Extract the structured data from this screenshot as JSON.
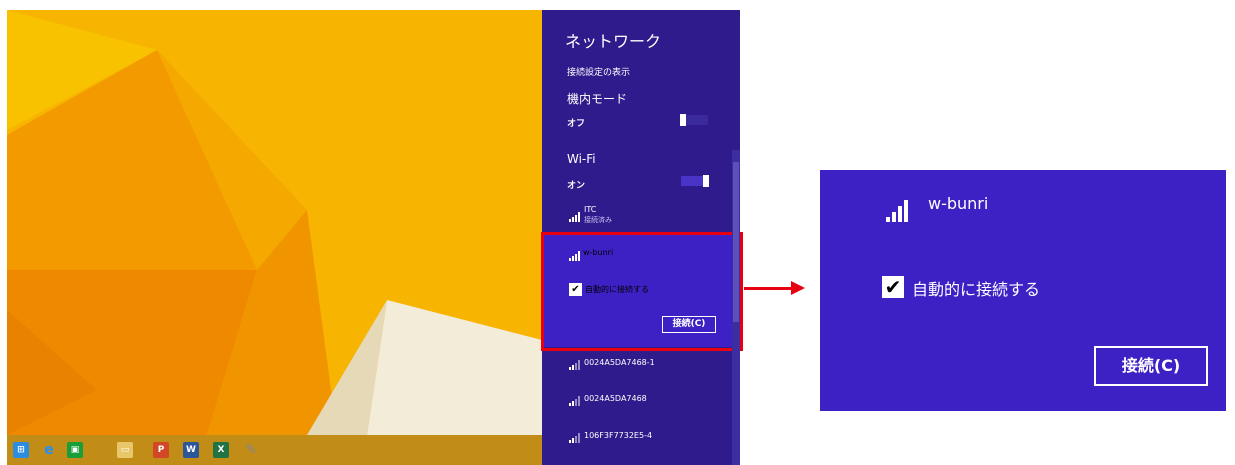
{
  "panel": {
    "title": "ネットワーク",
    "view_connection_settings": "接続設定の表示",
    "airplane_mode": {
      "label": "機内モード",
      "state": "オフ",
      "on": false
    },
    "wifi": {
      "label": "Wi-Fi",
      "state": "オン",
      "on": true
    },
    "networks": [
      {
        "ssid": "ITC",
        "status": "接続済み"
      },
      {
        "ssid": "w-bunri",
        "auto_connect_label": "自動的に接続する",
        "auto_connect_checked": true,
        "connect_button": "接続(C)"
      },
      {
        "ssid": "0024A5DA7468-1"
      },
      {
        "ssid": "0024A5DA7468"
      },
      {
        "ssid": "106F3F7732E5-4"
      }
    ]
  },
  "zoom": {
    "ssid": "w-bunri",
    "auto_connect_label": "自動的に接続する",
    "connect_button": "接続(C)"
  },
  "taskbar": {
    "icons": [
      "windows-start-icon",
      "internet-explorer-icon",
      "store-icon",
      "file-explorer-icon",
      "powerpoint-icon",
      "word-icon",
      "excel-icon",
      "paint-icon"
    ]
  },
  "colors": {
    "panel_bg": "#2f1b8b",
    "selected_bg": "#3d21c4",
    "highlight_red": "#e60012",
    "desktop_orange": "#f6b100"
  }
}
